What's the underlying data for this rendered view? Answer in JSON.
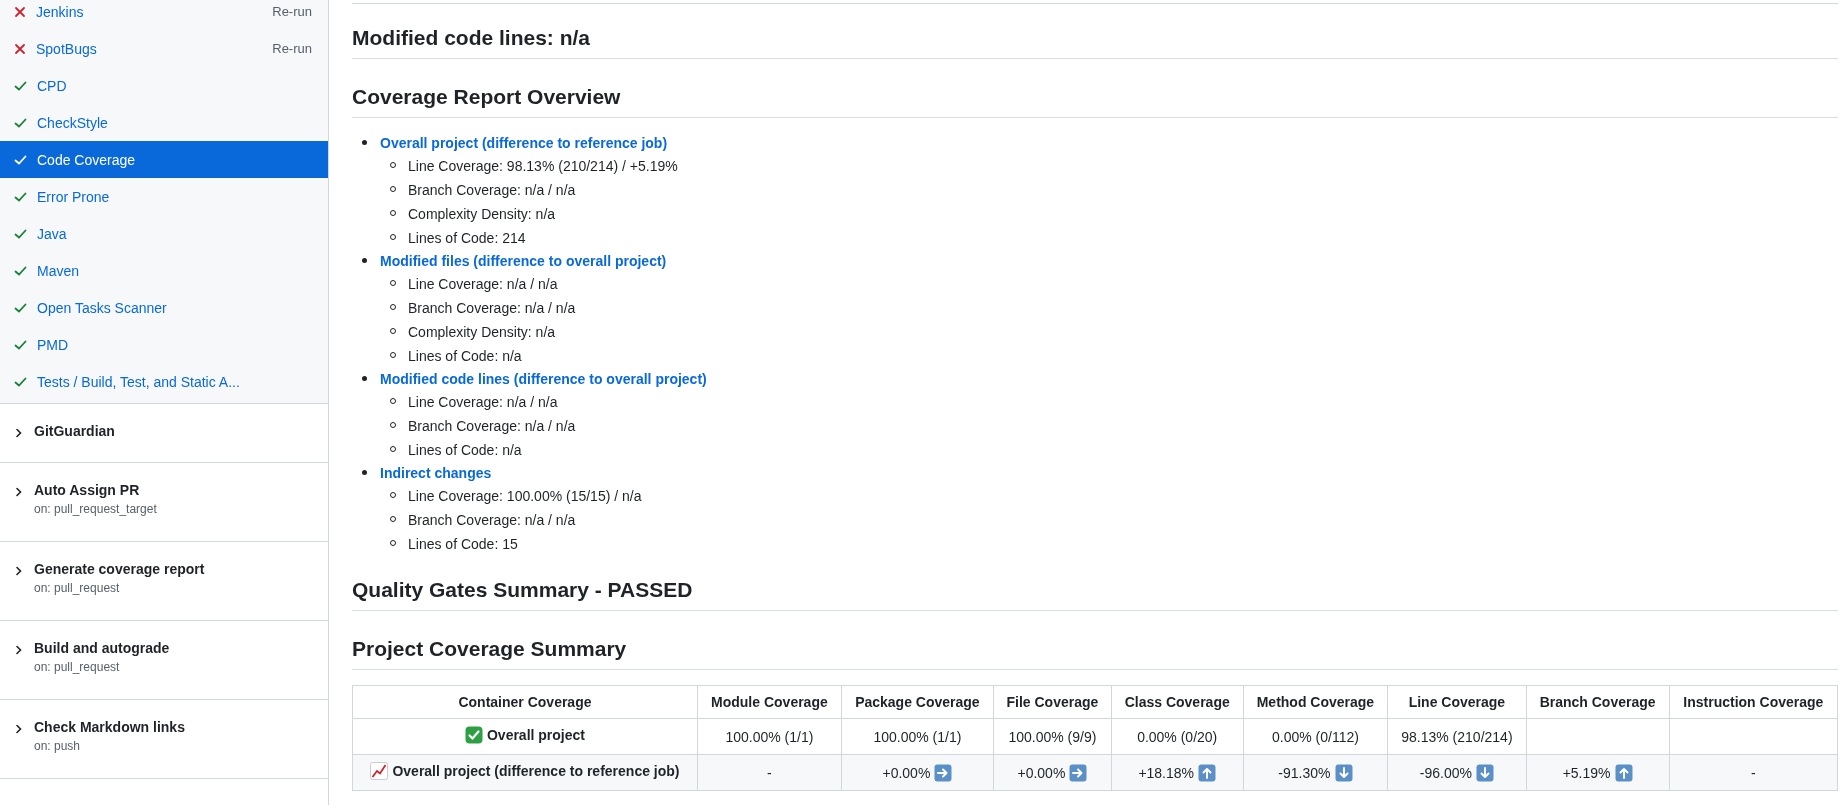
{
  "sidebar": {
    "checks": [
      {
        "name": "Jenkins",
        "kind": "failure",
        "action": "Re-run",
        "selected": false
      },
      {
        "name": "SpotBugs",
        "kind": "failure",
        "action": "Re-run",
        "selected": false
      },
      {
        "name": "CPD",
        "kind": "success",
        "selected": false
      },
      {
        "name": "CheckStyle",
        "kind": "success",
        "selected": false
      },
      {
        "name": "Code Coverage",
        "kind": "success",
        "selected": true
      },
      {
        "name": "Error Prone",
        "kind": "success",
        "selected": false
      },
      {
        "name": "Java",
        "kind": "success",
        "selected": false
      },
      {
        "name": "Maven",
        "kind": "success",
        "selected": false
      },
      {
        "name": "Open Tasks Scanner",
        "kind": "success",
        "selected": false
      },
      {
        "name": "PMD",
        "kind": "success",
        "selected": false
      },
      {
        "name": "Tests / Build, Test, and Static A...",
        "kind": "success",
        "selected": false
      }
    ],
    "workflows": [
      {
        "name": "GitGuardian",
        "expanded": false
      },
      {
        "name": "Auto Assign PR",
        "trigger": "on: pull_request_target",
        "expanded": false
      },
      {
        "name": "Generate coverage report",
        "trigger": "on: pull_request",
        "expanded": false
      },
      {
        "name": "Build and autograde",
        "trigger": "on: pull_request",
        "expanded": false
      },
      {
        "name": "Check Markdown links",
        "trigger": "on: push",
        "expanded": false
      }
    ]
  },
  "main": {
    "modified_heading": "Modified code lines: n/a",
    "overview": {
      "heading": "Coverage Report Overview",
      "groups": [
        {
          "title": "Overall project (difference to reference job)",
          "items": [
            "Line Coverage: 98.13% (210/214) / +5.19%",
            "Branch Coverage: n/a / n/a",
            "Complexity Density: n/a",
            "Lines of Code: 214"
          ]
        },
        {
          "title": "Modified files (difference to overall project)",
          "items": [
            "Line Coverage: n/a / n/a",
            "Branch Coverage: n/a / n/a",
            "Complexity Density: n/a",
            "Lines of Code: n/a"
          ]
        },
        {
          "title": "Modified code lines (difference to overall project)",
          "items": [
            "Line Coverage: n/a / n/a",
            "Branch Coverage: n/a / n/a",
            "Lines of Code: n/a"
          ]
        },
        {
          "title": "Indirect changes",
          "items": [
            "Line Coverage: 100.00% (15/15) / n/a",
            "Branch Coverage: n/a / n/a",
            "Lines of Code: 15"
          ]
        }
      ]
    },
    "quality_heading": "Quality Gates Summary - PASSED",
    "summary": {
      "heading": "Project Coverage Summary",
      "columns": [
        "Container Coverage",
        "Module Coverage",
        "Package Coverage",
        "File Coverage",
        "Class Coverage",
        "Method Coverage",
        "Line Coverage",
        "Branch Coverage",
        "Instruction Coverage"
      ],
      "rows": [
        {
          "cells": [
            {
              "kind": "check",
              "text": "Overall project"
            },
            {
              "text": "100.00% (1/1)"
            },
            {
              "text": "100.00% (1/1)"
            },
            {
              "text": "100.00% (9/9)"
            },
            {
              "text": "0.00% (0/20)"
            },
            {
              "text": "0.00% (0/112)"
            },
            {
              "text": "98.13% (210/214)"
            },
            {},
            {}
          ]
        },
        {
          "cells": [
            {
              "kind": "chart",
              "text": "Overall project (difference to reference job)"
            },
            {
              "text": "-"
            },
            {
              "text": "+0.00%",
              "kind": "right"
            },
            {
              "text": "+0.00%",
              "kind": "right"
            },
            {
              "text": "+18.18%",
              "kind": "up"
            },
            {
              "text": "-91.30%",
              "kind": "down"
            },
            {
              "text": "-96.00%",
              "kind": "down"
            },
            {
              "text": "+5.19%",
              "kind": "up"
            },
            {
              "text": "-"
            }
          ]
        }
      ]
    }
  }
}
